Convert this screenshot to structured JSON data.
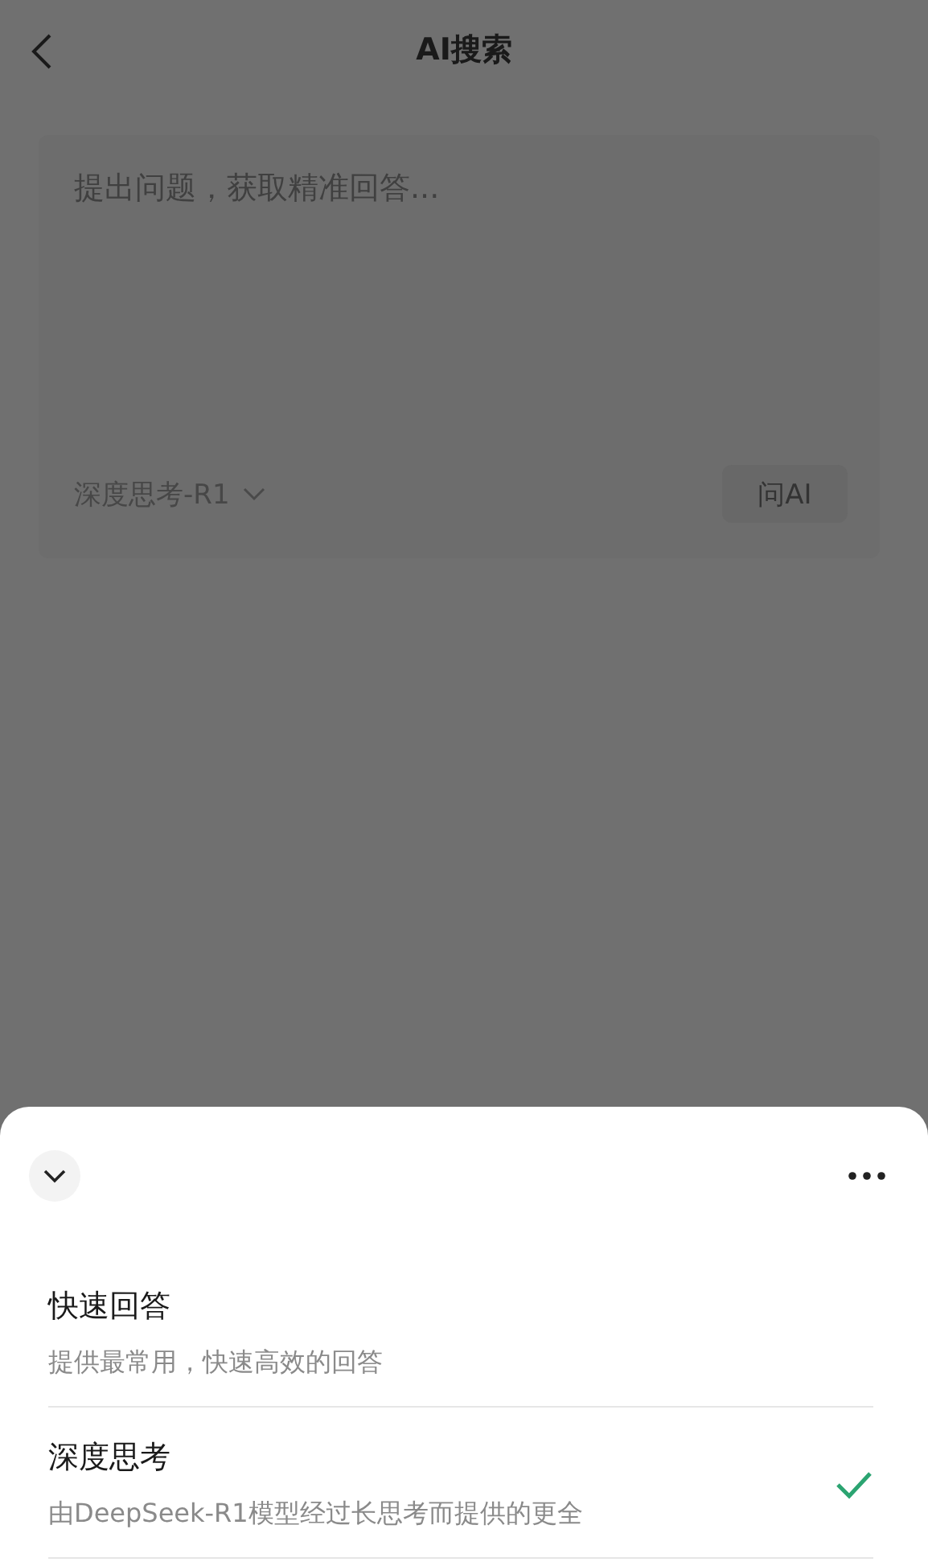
{
  "header": {
    "title": "AI搜索"
  },
  "composer": {
    "placeholder": "提出问题，获取精准回答...",
    "model": "深度思考-R1",
    "send_button": {
      "label": "问AI",
      "disabled": true
    }
  },
  "sheet": {
    "options": [
      {
        "title": "快速回答",
        "description": "提供最常用，快速高效的回答",
        "selected": false
      },
      {
        "title": "深度思考",
        "description": "由DeepSeek-R1模型经过长思考而提供的更全",
        "selected": true
      }
    ]
  }
}
